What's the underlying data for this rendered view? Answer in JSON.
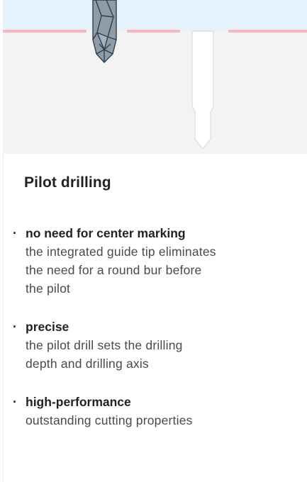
{
  "illustration": {
    "icons": [
      "drill-bit-icon",
      "pilot-hole-icon"
    ],
    "colors": {
      "gingiva": "#e6f2fb",
      "bone": "#f3f3f3",
      "marking_line": "#f3b7c2",
      "drill_outline": "#2f3f4f",
      "drill_fill": "#8a97a3",
      "hole_fill": "#ffffff",
      "hole_outline": "#cfcfcf"
    }
  },
  "section": {
    "title": "Pilot drilling"
  },
  "features": [
    {
      "bullet": "·",
      "heading": "no need for center marking",
      "lines": [
        "the integrated guide tip eliminates",
        "the need for a round bur before",
        "the pilot"
      ]
    },
    {
      "bullet": "·",
      "heading": "precise",
      "lines": [
        "the pilot drill sets the drilling",
        "depth and drilling axis"
      ]
    },
    {
      "bullet": "·",
      "heading": "high-performance",
      "lines": [
        "outstanding cutting properties"
      ]
    }
  ]
}
